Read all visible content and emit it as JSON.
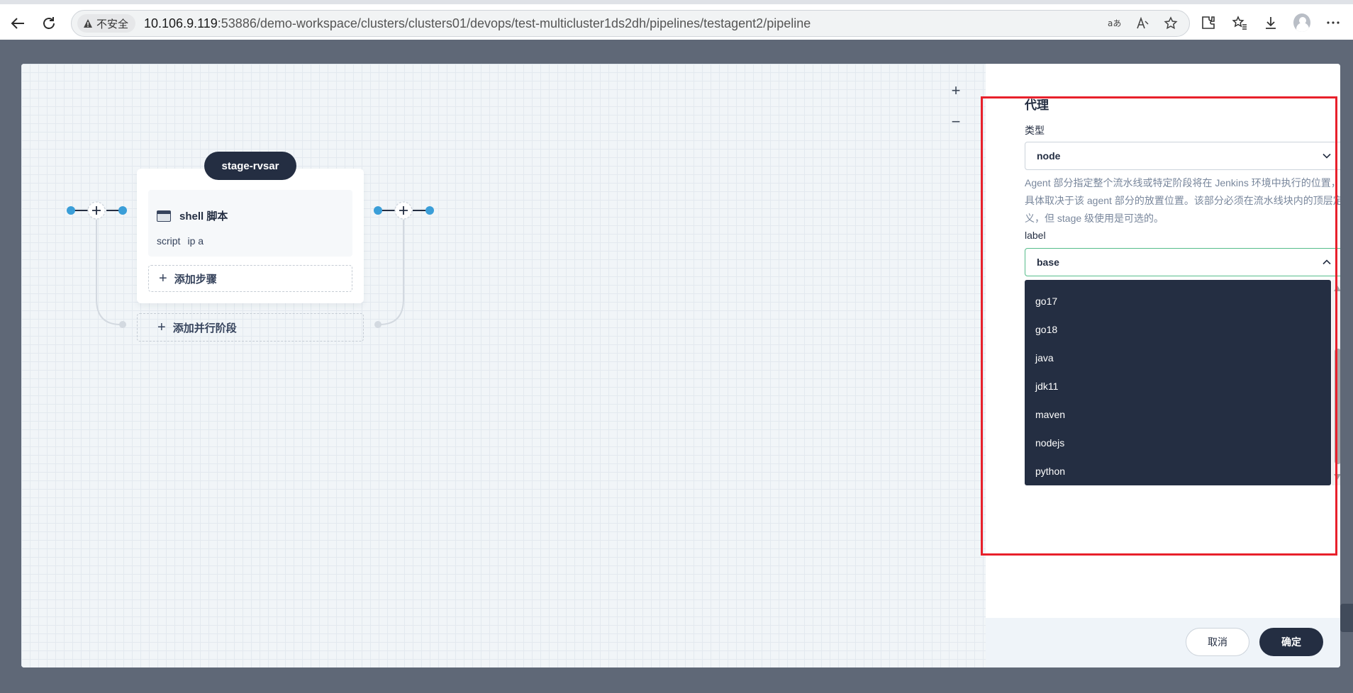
{
  "browser": {
    "insecure_label": "不安全",
    "url_host": "10.106.9.119",
    "url_rest": ":53886/demo-workspace/clusters/clusters01/devops/test-multicluster1ds2dh/pipelines/testagent2/pipeline"
  },
  "canvas": {
    "zoom_in": "+",
    "zoom_out": "−",
    "stage_name": "stage-rvsar",
    "step_title": "shell 脚本",
    "step_key": "script",
    "step_value": "ip a",
    "add_step": "添加步骤",
    "add_parallel": "添加并行阶段"
  },
  "panel": {
    "section_title": "代理",
    "type_label": "类型",
    "type_value": "node",
    "description": "Agent 部分指定整个流水线或特定阶段将在 Jenkins 环境中执行的位置， 具体取决于该 agent 部分的放置位置。该部分必须在流水线块内的顶层定义，但 stage 级使用是可选的。",
    "label_label": "label",
    "label_value": "base",
    "options": [
      "go17",
      "go18",
      "java",
      "jdk11",
      "maven",
      "nodejs",
      "python"
    ],
    "cancel": "取消",
    "confirm": "确定"
  },
  "colors": {
    "dark": "#242e42",
    "accent_green": "#55bc8a",
    "connector_blue": "#3a9ed8",
    "highlight_red": "#e8202b"
  }
}
